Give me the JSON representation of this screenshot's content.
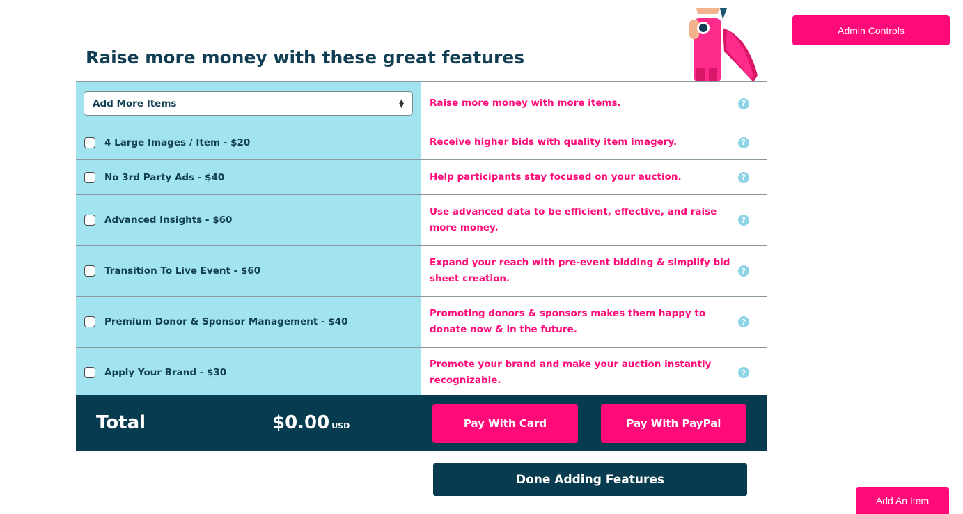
{
  "header": {
    "admin_controls_label": "Admin Controls",
    "title": "Raise more money with these great features"
  },
  "features": {
    "select": {
      "value": "Add More Items",
      "description": "Raise more money with more items."
    },
    "items": [
      {
        "label": "4 Large Images / Item - $20",
        "description": "Receive higher bids with quality item imagery.",
        "checked": false
      },
      {
        "label": "No 3rd Party Ads - $40",
        "description": "Help participants stay focused on your auction.",
        "checked": false
      },
      {
        "label": "Advanced Insights - $60",
        "description": "Use advanced data to be efficient, effective, and raise more money.",
        "checked": false
      },
      {
        "label": "Transition To Live Event - $60",
        "description": "Expand your reach with pre-event bidding & simplify bid sheet creation.",
        "checked": false
      },
      {
        "label": "Premium Donor & Sponsor Management - $40",
        "description": "Promoting donors & sponsors makes them happy to donate now & in the future.",
        "checked": false
      },
      {
        "label": "Apply Your Brand - $30",
        "description": "Promote your brand and make your auction instantly recognizable.",
        "checked": false
      }
    ],
    "help_glyph": "?"
  },
  "total": {
    "label": "Total",
    "amount": "$0.00",
    "currency": "USD",
    "pay_card_label": "Pay With Card",
    "pay_paypal_label": "Pay With PayPal"
  },
  "footer": {
    "done_label": "Done Adding Features",
    "add_item_label": "Add An Item"
  },
  "colors": {
    "accent_pink": "#ff0a78",
    "navy": "#073b50",
    "light_blue": "#a1e3ee",
    "heading": "#123e54"
  }
}
